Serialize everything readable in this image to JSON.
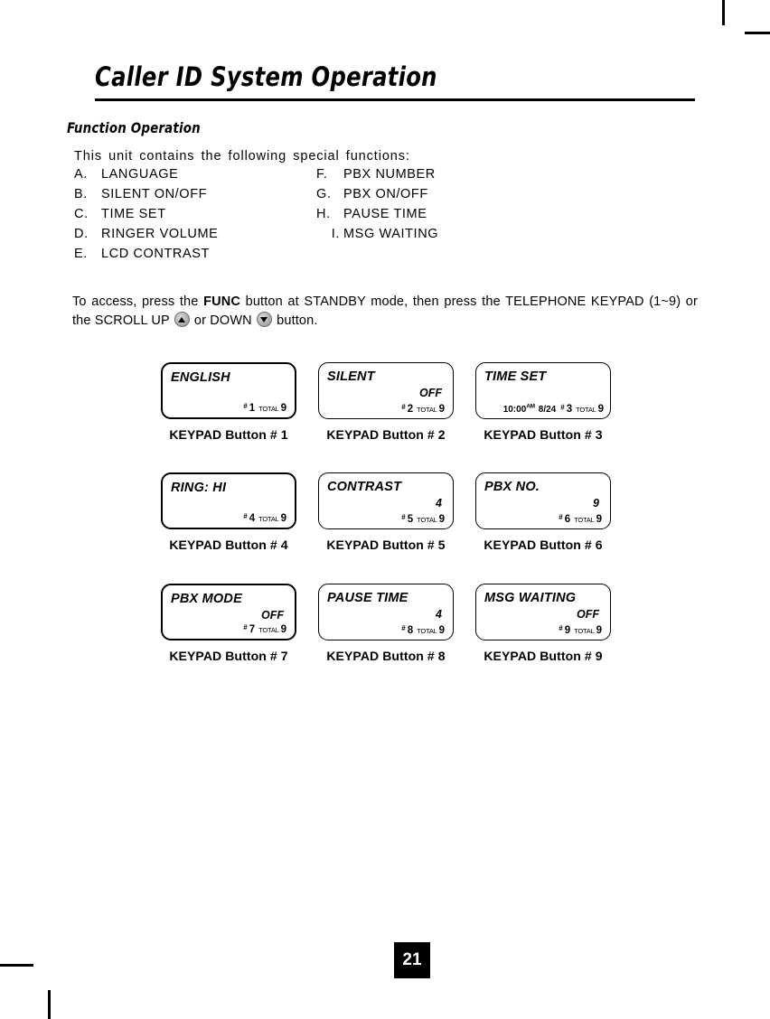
{
  "document": {
    "chapter_title": "Caller ID System Operation",
    "section_heading": "Function Operation",
    "page_number": "21"
  },
  "intro": {
    "text": "This unit contains the following special functions:"
  },
  "function_list": [
    {
      "left_letter": "A.",
      "left_label": "LANGUAGE",
      "right_letter": "F.",
      "right_label": "PBX NUMBER"
    },
    {
      "left_letter": "B.",
      "left_label": "SILENT ON/OFF",
      "right_letter": "G.",
      "right_label": "PBX ON/OFF"
    },
    {
      "left_letter": "C.",
      "left_label": "TIME SET",
      "right_letter": "H.",
      "right_label": "PAUSE TIME"
    },
    {
      "left_letter": "D.",
      "left_label": "RINGER VOLUME",
      "right_letter": "I.",
      "right_label": "MSG WAITING"
    },
    {
      "left_letter": "E.",
      "left_label": "LCD CONTRAST",
      "right_letter": "",
      "right_label": ""
    }
  ],
  "access": {
    "part1": "To access, press the ",
    "func_label": "FUNC",
    "part2": " button at STANDBY mode, then press the TELEPHONE KEYPAD (1~9) or the SCROLL UP ",
    "up_icon": "triangle-up-icon",
    "part3": " or DOWN ",
    "down_icon": "triangle-down-icon",
    "part4": " button."
  },
  "lcd_screens": [
    {
      "line1": "ENGLISH",
      "line2": "",
      "hash": "#",
      "index": "1",
      "total_label": "TOTAL",
      "total": "9",
      "time": "",
      "meridiem": "",
      "date": "",
      "caption": "KEYPAD Button # 1",
      "border": "thick"
    },
    {
      "line1": "SILENT",
      "line2": "OFF",
      "hash": "#",
      "index": "2",
      "total_label": "TOTAL",
      "total": "9",
      "time": "",
      "meridiem": "",
      "date": "",
      "caption": "KEYPAD Button # 2",
      "border": "thin"
    },
    {
      "line1": "TIME SET",
      "line2": "",
      "hash": "#",
      "index": "3",
      "total_label": "TOTAL",
      "total": "9",
      "time": "10:00",
      "meridiem": "AM",
      "date": "8/24",
      "caption": "KEYPAD Button # 3",
      "border": "thin"
    },
    {
      "line1": "RING: HI",
      "line2": "",
      "hash": "#",
      "index": "4",
      "total_label": "TOTAL",
      "total": "9",
      "time": "",
      "meridiem": "",
      "date": "",
      "caption": "KEYPAD Button # 4",
      "border": "thick"
    },
    {
      "line1": "CONTRAST",
      "line2": "4",
      "hash": "#",
      "index": "5",
      "total_label": "TOTAL",
      "total": "9",
      "time": "",
      "meridiem": "",
      "date": "",
      "caption": "KEYPAD Button # 5",
      "border": "thin"
    },
    {
      "line1": "PBX NO.",
      "line2": "9",
      "hash": "#",
      "index": "6",
      "total_label": "TOTAL",
      "total": "9",
      "time": "",
      "meridiem": "",
      "date": "",
      "caption": "KEYPAD Button # 6",
      "border": "thin"
    },
    {
      "line1": "PBX MODE",
      "line2": "OFF",
      "hash": "#",
      "index": "7",
      "total_label": "TOTAL",
      "total": "9",
      "time": "",
      "meridiem": "",
      "date": "",
      "caption": "KEYPAD Button # 7",
      "border": "thick"
    },
    {
      "line1": "PAUSE TIME",
      "line2": "4",
      "hash": "#",
      "index": "8",
      "total_label": "TOTAL",
      "total": "9",
      "time": "",
      "meridiem": "",
      "date": "",
      "caption": "KEYPAD Button # 8",
      "border": "thin"
    },
    {
      "line1": "MSG WAITING",
      "line2": "OFF",
      "hash": "#",
      "index": "9",
      "total_label": "TOTAL",
      "total": "9",
      "time": "",
      "meridiem": "",
      "date": "",
      "caption": "KEYPAD Button # 9",
      "border": "thin"
    }
  ],
  "colors": {
    "ink": "#000000",
    "paper": "#ffffff",
    "button_face": "#b4b4b4"
  }
}
